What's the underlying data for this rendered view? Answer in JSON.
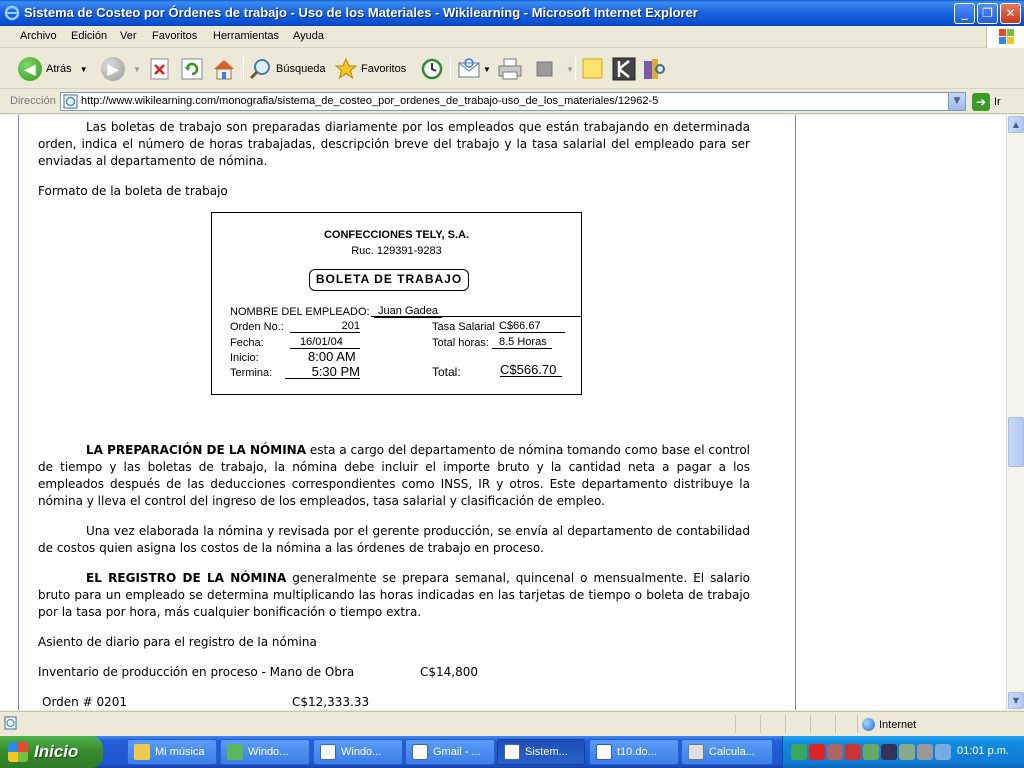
{
  "window": {
    "title": "Sistema de Costeo por Órdenes de trabajo - Uso de los Materiales - Wikilearning - Microsoft Internet Explorer",
    "buttons": {
      "minimize": "_",
      "maximize": "❐",
      "close": "✕"
    }
  },
  "menu": [
    "Archivo",
    "Edición",
    "Ver",
    "Favoritos",
    "Herramientas",
    "Ayuda"
  ],
  "toolbar": {
    "back_label": "Atrás",
    "search_label": "Búsqueda",
    "favorites_label": "Favoritos"
  },
  "address": {
    "label": "Dirección",
    "url": "http://www.wikilearning.com/monografia/sistema_de_costeo_por_ordenes_de_trabajo-uso_de_los_materiales/12962-5",
    "go_label": "Ir"
  },
  "content": {
    "p1": "Las boletas de trabajo son preparadas diariamente por los empleados que están trabajando en determinada orden, indica el número de horas trabajadas, descripción breve del trabajo y la tasa salarial del empleado para ser enviadas al departamento de nómina.",
    "formato": "Formato de la boleta de trabajo",
    "boleta": {
      "company": "CONFECCIONES TELY, S.A.",
      "ruc": "Ruc. 129391-9283",
      "title": "BOLETA DE TRABAJO",
      "employee_label": "NOMBRE DEL EMPLEADO:",
      "employee": "Juan Gadea",
      "order_label": "Orden No.:",
      "order": "201",
      "date_label": "Fecha:",
      "date": "16/01/04",
      "start_label": "Inicio:",
      "start": "8:00 AM",
      "end_label": "Termina:",
      "end": "5:30 PM",
      "rate_label": "Tasa Salarial",
      "rate": "C$66.67",
      "hours_label": "Total horas:",
      "hours": "8.5 Horas",
      "total_label": "Total:",
      "total": "C$566.70"
    },
    "p2_bold": "LA PREPARACIÓN DE LA NÓMINA",
    "p2": " esta a cargo del departamento de nómina tomando como base el control de tiempo y las boletas de trabajo, la nómina debe incluir el importe bruto y la cantidad neta a pagar a los empleados después de las deducciones correspondientes como INSS, IR y otros. Este departamento distribuye la nómina y lleva el control del ingreso de los empleados, tasa salarial y clasificación de empleo.",
    "p3": "Una vez elaborada la nómina y revisada por el gerente producción, se envía al departamento de contabilidad de costos quien asigna los costos de la nómina a las órdenes de trabajo en proceso.",
    "p4_bold": "EL REGISTRO DE LA NÓMINA",
    "p4": " generalmente se prepara semanal, quincenal o mensualmente. El salario bruto para un empleado se determina multiplicando las horas indicadas en las tarjetas de tiempo o boleta de trabajo por la tasa por hora, más cualquier bonificación o tiempo extra.",
    "asiento": "Asiento de diario para el registro de la nómina",
    "inv_label": "Inventario de producción en proceso - Mano de Obra",
    "inv_amount": "C$14,800",
    "orden_label": "Orden # 0201",
    "orden_amount": "C$12,333.33"
  },
  "status": {
    "zone": "Internet"
  },
  "taskbar": {
    "start": "Inicio",
    "tasks": [
      "Mi música",
      "Windo...",
      "Windo...",
      "Gmail - ...",
      "Sistem...",
      "t10.do...",
      "Calcula..."
    ],
    "clock": "01:01 p.m."
  },
  "colors": {
    "title_blue": "#0b4fd0",
    "frame_line": "#6d8bc4",
    "start_green": "#378a2e"
  }
}
